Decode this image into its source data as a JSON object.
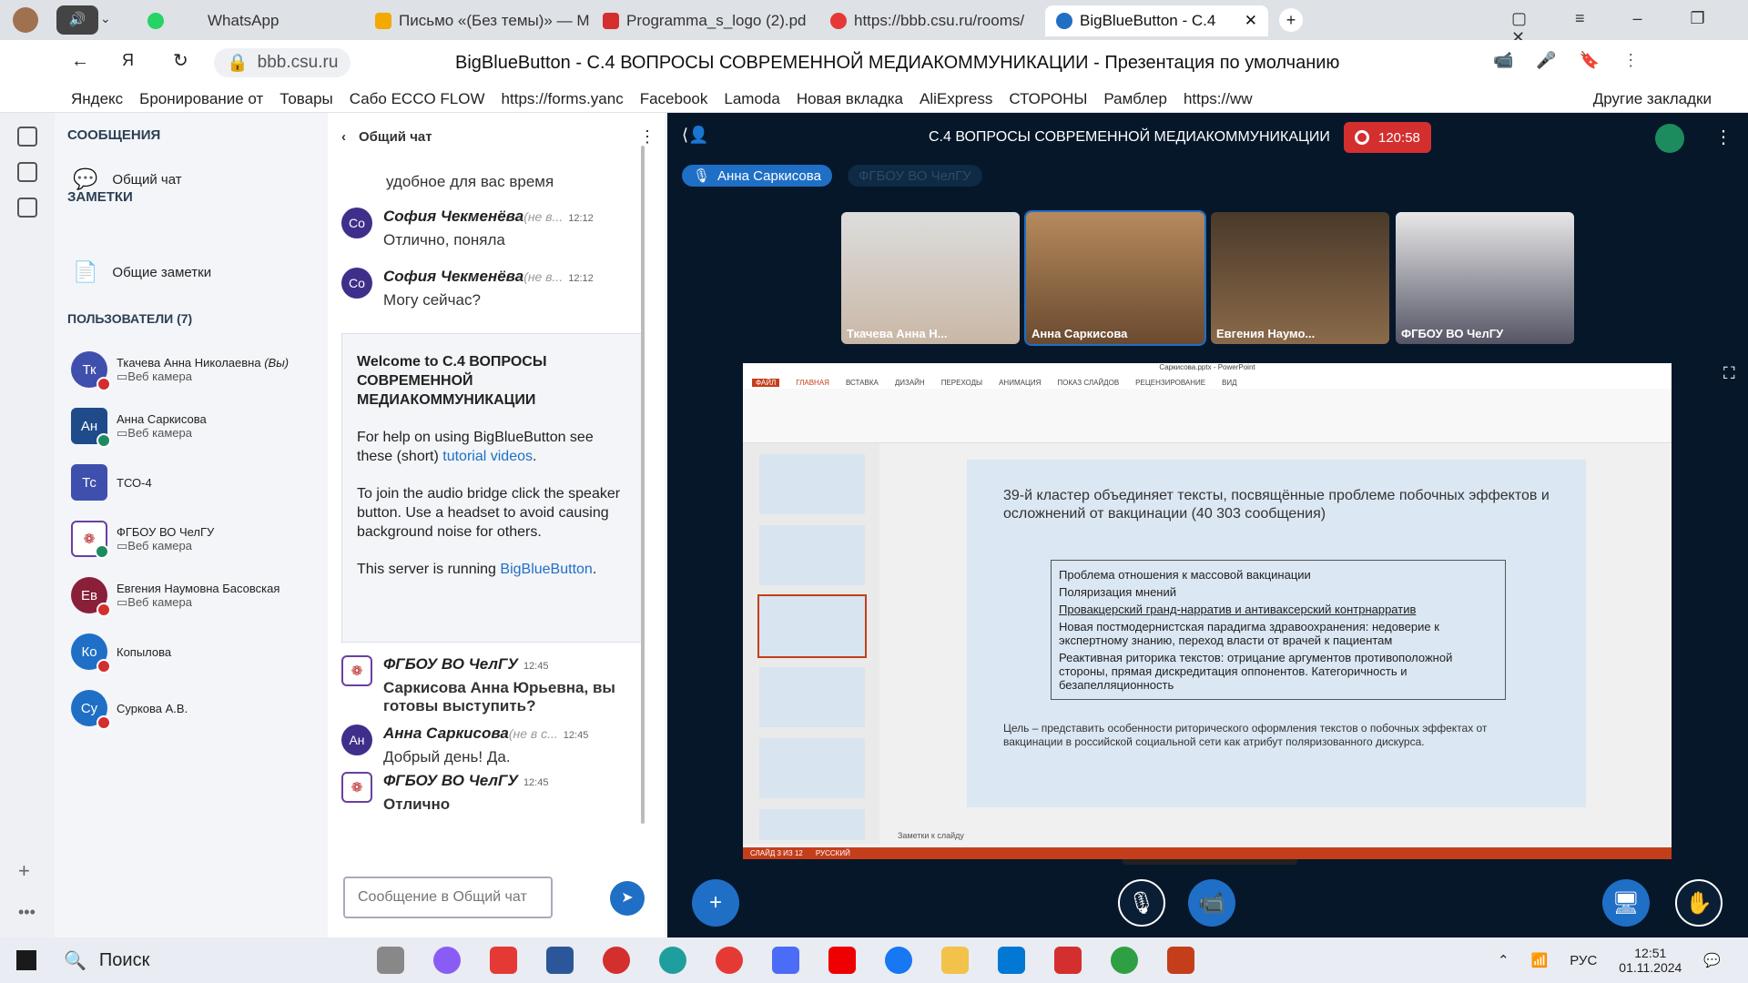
{
  "browser": {
    "tabs": [
      "WhatsApp",
      "Письмо «(Без темы)» — M",
      "Programma_s_logo (2).pd",
      "https://bbb.csu.ru/rooms/",
      "BigBlueButton - С.4"
    ],
    "url": "bbb.csu.ru",
    "page_title": "BigBlueButton - С.4 ВОПРОСЫ СОВРЕМЕННОЙ МЕДИАКОММУНИКАЦИИ - Презентация по умолчанию",
    "bookmarks": [
      "Яндекс",
      "Бронирование от",
      "Товары",
      "Сабо ECCO FLOW",
      "https://forms.yanc",
      "Facebook",
      "Lamoda",
      "Новая вкладка",
      "AliExpress",
      "СТОРОНЫ",
      "Рамблер",
      "https://ww"
    ],
    "other_bookmarks": "Другие закладки"
  },
  "sidebar": {
    "messages_header": "СООБЩЕНИЯ",
    "public_chat": "Общий чат",
    "notes_header": "ЗАМЕТКИ",
    "shared_notes": "Общие заметки",
    "users_header": "ПОЛЬЗОВАТЕЛИ (7)",
    "users": [
      {
        "initials": "Тк",
        "name": "Ткачева Анна Николаевна",
        "you": "(Вы)",
        "status": "Веб камера",
        "color": "#3f4fae"
      },
      {
        "initials": "Ан",
        "name": "Анна Саркисова",
        "status": "Веб камера",
        "color": "#1f4b8a"
      },
      {
        "initials": "Тс",
        "name": "ТСО-4",
        "status": "",
        "color": "#3f4fae"
      },
      {
        "initials": "",
        "name": "ФГБОУ ВО ЧелГУ",
        "status": "Веб камера",
        "color": "#ffffff"
      },
      {
        "initials": "Ев",
        "name": "Евгения Наумовна Басовская",
        "status": "Веб камера",
        "color": "#8a1f3a"
      },
      {
        "initials": "Ко",
        "name": "Копылова",
        "status": "",
        "color": "#1f6fc6"
      },
      {
        "initials": "Су",
        "name": "Суркова А.В.",
        "status": "",
        "color": "#1f6fc6"
      }
    ]
  },
  "chat": {
    "title": "Общий чат",
    "top_partial": "удобное для вас время",
    "messages": [
      {
        "initials": "Со",
        "name": "София Чекменёва",
        "note": "(не в...",
        "time": "12:12",
        "text": "Отлично, поняла"
      },
      {
        "initials": "Со",
        "name": "София Чекменёва",
        "note": "(не в...",
        "time": "12:12",
        "text": "Могу сейчас?"
      }
    ],
    "welcome": {
      "line1": "Welcome to",
      "title": "С.4 ВОПРОСЫ СОВРЕМЕННОЙ МЕДИАКОММУНИКАЦИИ",
      "help": "For help on using BigBlueButton see these (short)",
      "link": "tutorial videos",
      "audio": "To join the audio bridge click the speaker button. Use a headset to avoid causing background noise for others.",
      "server": "This server is running",
      "server_link": "BigBlueButton"
    },
    "messages2": [
      {
        "initials": "",
        "name": "ФГБОУ ВО ЧелГУ",
        "time": "12:45",
        "text": "Саркисова Анна Юрьевна, вы готовы выступить?"
      },
      {
        "initials": "Ан",
        "name": "Анна Саркисова",
        "note": "(не в с...",
        "time": "12:45",
        "text": "Добрый день! Да."
      },
      {
        "initials": "",
        "name": "ФГБОУ ВО ЧелГУ",
        "time": "12:45",
        "text": "Отлично"
      }
    ],
    "input_placeholder": "Сообщение в Общий чат"
  },
  "stage": {
    "title": "С.4 ВОПРОСЫ СОВРЕМЕННОЙ МЕДИАКОММУНИКАЦИИ",
    "timer": "120:58",
    "talker": "Анна Саркисова",
    "talker2": "ФГБОУ ВО ЧелГУ",
    "videos": [
      "Ткачева Анна Н...",
      "Анна Саркисова",
      "Евгения Наумо...",
      "ФГБОУ ВО ЧелГУ"
    ],
    "tooltip": "Выключить веб-камеру"
  },
  "slide": {
    "title": "39-й кластер объединяет тексты, посвящённые проблеме побочных эффектов и осложнений от вакцинации (40 303 сообщения)",
    "bullets": [
      "Проблема отношения к массовой вакцинации",
      "Поляризация мнений",
      "Провакцерский гранд-нарратив и антиваксерский контрнарратив",
      "Новая постмодернистская парадигма здравоохранения: недоверие к экспертному знанию, переход власти от врачей к пациентам",
      "Реактивная риторика текстов: отрицание аргументов противоположной стороны, прямая дискредитация оппонентов. Категоричность и безапелляционность"
    ],
    "goal": "Цель – представить особенности риторического оформления текстов о побочных эффектах от вакцинации в российской социальной сети как атрибут поляризованного дискурса.",
    "file": "Саркисова.pptx - PowerPoint",
    "ribbon_tabs": [
      "ФАЙЛ",
      "ГЛАВНАЯ",
      "ВСТАВКА",
      "ДИЗАЙН",
      "ПЕРЕХОДЫ",
      "АНИМАЦИЯ",
      "ПОКАЗ СЛАЙДОВ",
      "РЕЦЕНЗИРОВАНИЕ",
      "ВИД"
    ],
    "notes": "Заметки к слайду",
    "status": "СЛАЙД 3 ИЗ 12",
    "lang": "РУССКИЙ"
  },
  "taskbar": {
    "search": "Поиск",
    "lang": "РУС",
    "time": "12:51",
    "date": "01.11.2024"
  }
}
